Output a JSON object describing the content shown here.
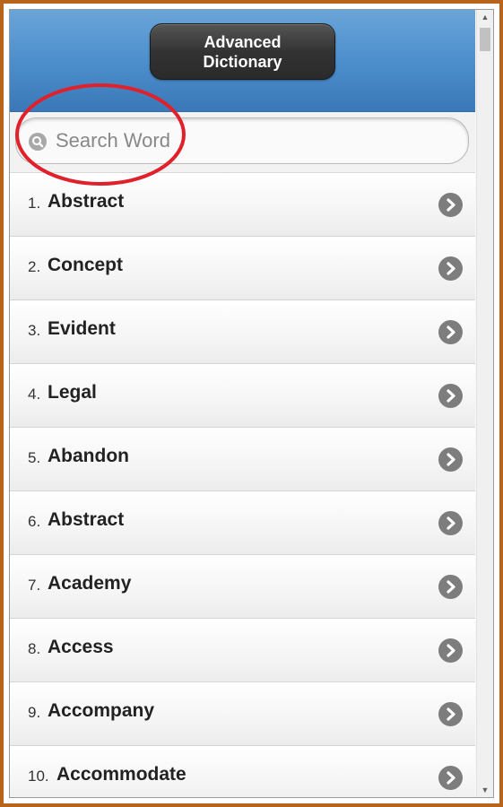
{
  "header": {
    "title": "Advanced\nDictionary"
  },
  "search": {
    "placeholder": "Search Word"
  },
  "words": [
    {
      "num": "1.",
      "word": "Abstract"
    },
    {
      "num": "2.",
      "word": "Concept"
    },
    {
      "num": "3.",
      "word": "Evident"
    },
    {
      "num": "4.",
      "word": "Legal"
    },
    {
      "num": "5.",
      "word": "Abandon"
    },
    {
      "num": "6.",
      "word": "Abstract"
    },
    {
      "num": "7.",
      "word": "Academy"
    },
    {
      "num": "8.",
      "word": "Access"
    },
    {
      "num": "9.",
      "word": "Accompany"
    },
    {
      "num": "10.",
      "word": "Accommodate"
    }
  ],
  "icons": {
    "search": "search-icon",
    "arrow": "chevron-right-icon"
  },
  "colors": {
    "header": "#4d8fcc",
    "highlight": "#e0202a",
    "frame": "#b8651b"
  }
}
